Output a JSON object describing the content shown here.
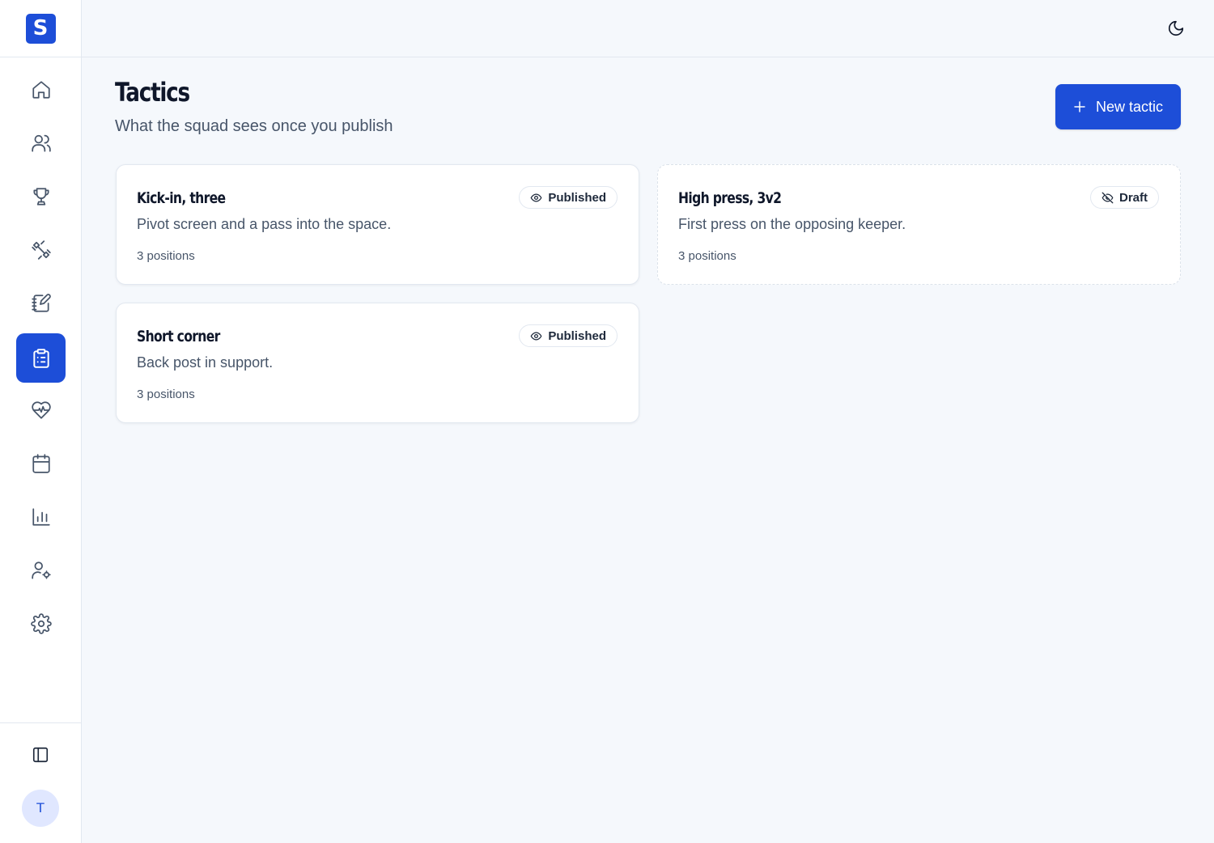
{
  "app": {
    "logo_letter": "S"
  },
  "sidebar": {
    "items": [
      {
        "name": "home",
        "icon": "home-icon",
        "active": false
      },
      {
        "name": "players",
        "icon": "users-icon",
        "active": false
      },
      {
        "name": "competitions",
        "icon": "trophy-icon",
        "active": false
      },
      {
        "name": "training",
        "icon": "dumbbell-icon",
        "active": false
      },
      {
        "name": "notes",
        "icon": "notebook-pen-icon",
        "active": false
      },
      {
        "name": "tactics",
        "icon": "clipboard-list-icon",
        "active": true
      },
      {
        "name": "health",
        "icon": "heart-pulse-icon",
        "active": false
      },
      {
        "name": "calendar",
        "icon": "calendar-icon",
        "active": false
      },
      {
        "name": "stats",
        "icon": "bar-chart-icon",
        "active": false
      },
      {
        "name": "staff",
        "icon": "user-cog-icon",
        "active": false
      },
      {
        "name": "settings",
        "icon": "gear-icon",
        "active": false
      }
    ],
    "avatar_initial": "T"
  },
  "header": {
    "theme_toggle_icon": "moon-icon"
  },
  "page": {
    "title": "Tactics",
    "subtitle": "What the squad sees once you publish",
    "new_button_label": "New tactic"
  },
  "tactics": [
    {
      "title": "Kick-in, three",
      "description": "Pivot screen and a pass into the space.",
      "meta": "3 positions",
      "status": "Published",
      "status_icon": "eye-icon"
    },
    {
      "title": "High press, 3v2",
      "description": "First press on the opposing keeper.",
      "meta": "3 positions",
      "status": "Draft",
      "status_icon": "eye-off-icon"
    },
    {
      "title": "Short corner",
      "description": "Back post in support.",
      "meta": "3 positions",
      "status": "Published",
      "status_icon": "eye-icon"
    }
  ],
  "colors": {
    "accent": "#1d4ed8",
    "background": "#f5f8fc",
    "text_muted": "#475569"
  }
}
